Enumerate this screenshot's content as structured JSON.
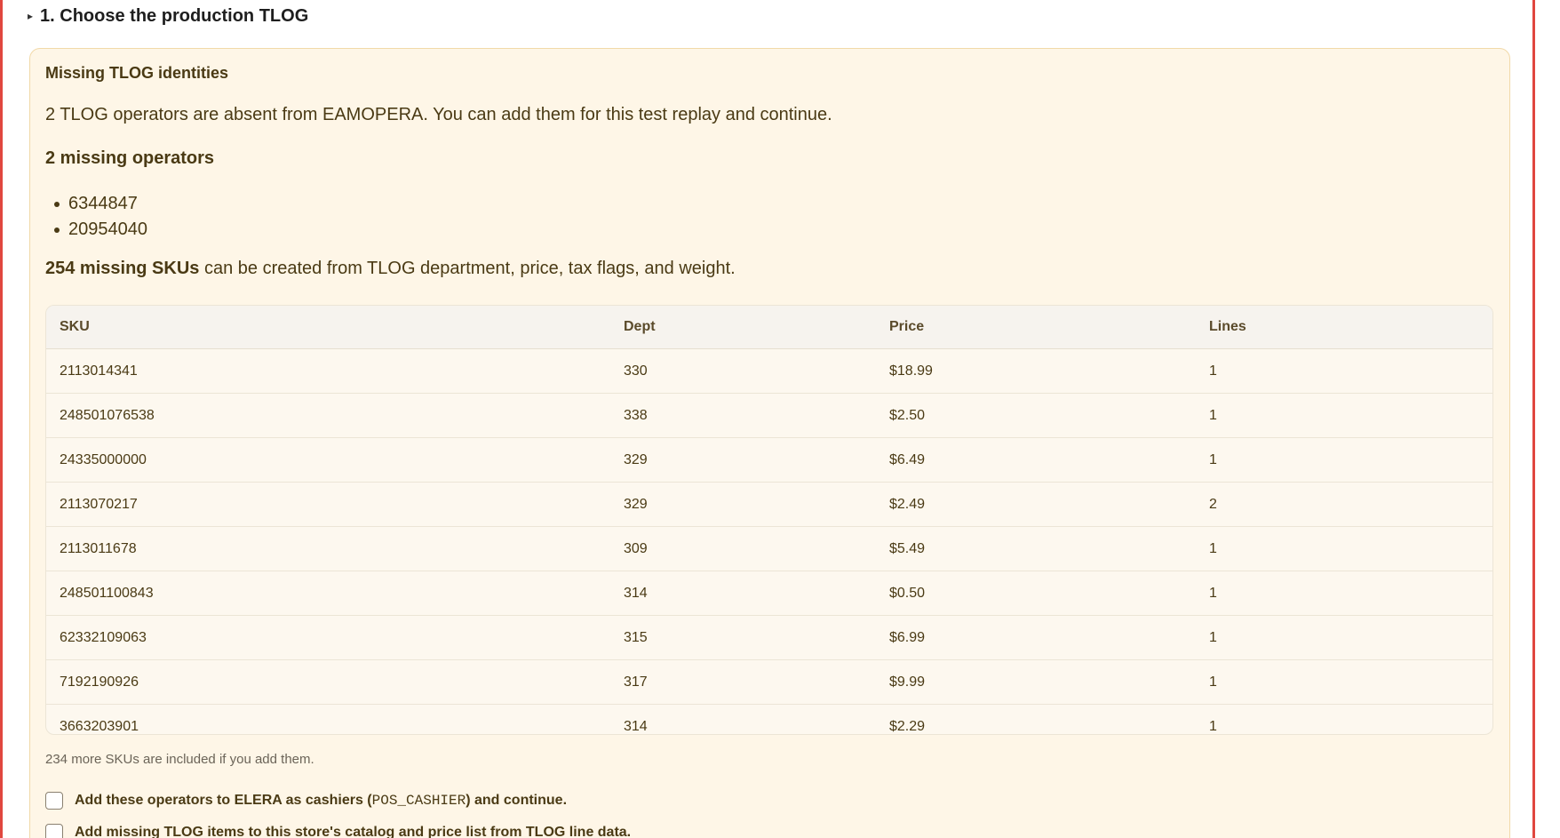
{
  "section": {
    "toggle_glyph": "▸",
    "title": "1. Choose the production TLOG"
  },
  "panel": {
    "title": "Missing TLOG identities",
    "description": "2 TLOG operators are absent from EAMOPERA. You can add them for this test replay and continue.",
    "operators_heading": "2 missing operators",
    "operators": [
      "6344847",
      "20954040"
    ],
    "sku_count_bold": "254 missing SKUs",
    "sku_count_rest": " can be created from TLOG department, price, tax flags, and weight.",
    "footnote": "234 more SKUs are included if you add them."
  },
  "table": {
    "headers": {
      "sku": "SKU",
      "dept": "Dept",
      "price": "Price",
      "lines": "Lines"
    },
    "rows": [
      {
        "sku": "2113014341",
        "dept": "330",
        "price": "$18.99",
        "lines": "1"
      },
      {
        "sku": "248501076538",
        "dept": "338",
        "price": "$2.50",
        "lines": "1"
      },
      {
        "sku": "24335000000",
        "dept": "329",
        "price": "$6.49",
        "lines": "1"
      },
      {
        "sku": "2113070217",
        "dept": "329",
        "price": "$2.49",
        "lines": "2"
      },
      {
        "sku": "2113011678",
        "dept": "309",
        "price": "$5.49",
        "lines": "1"
      },
      {
        "sku": "248501100843",
        "dept": "314",
        "price": "$0.50",
        "lines": "1"
      },
      {
        "sku": "62332109063",
        "dept": "315",
        "price": "$6.99",
        "lines": "1"
      },
      {
        "sku": "7192190926",
        "dept": "317",
        "price": "$9.99",
        "lines": "1"
      },
      {
        "sku": "3663203901",
        "dept": "314",
        "price": "$2.29",
        "lines": "1"
      }
    ]
  },
  "options": {
    "add_operators_prefix": "Add these operators to ELERA as cashiers (",
    "add_operators_code": "POS_CASHIER",
    "add_operators_suffix": ") and continue.",
    "add_items_label": "Add missing TLOG items to this store's catalog and price list from TLOG line data."
  },
  "colors": {
    "accent_border": "#e0473f",
    "panel_bg": "#fef6e7",
    "panel_border": "#f1d9a8",
    "text_warning": "#4a3a14"
  }
}
